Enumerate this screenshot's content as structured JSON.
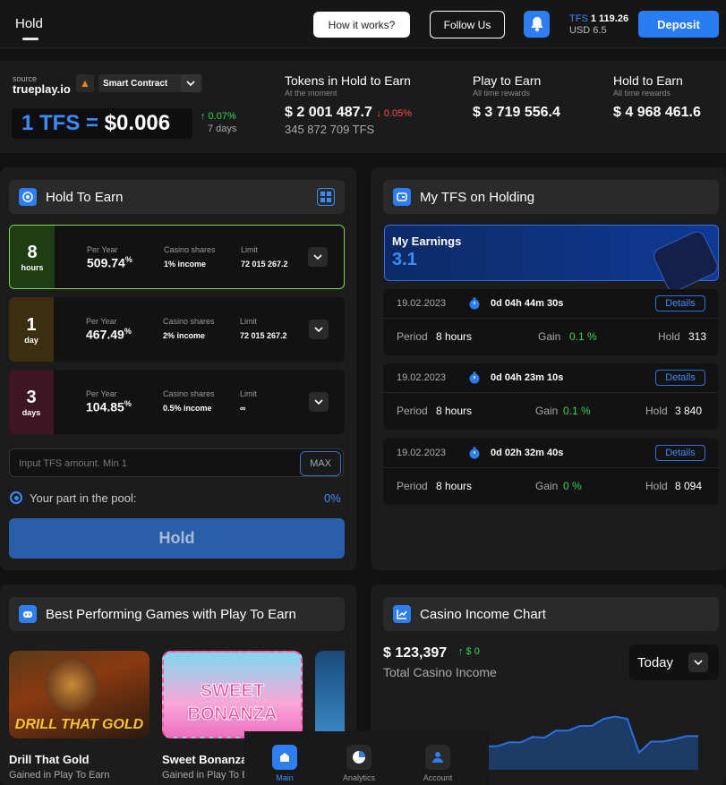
{
  "topbar": {
    "title": "Hold",
    "how_it_works": "How it works?",
    "follow_us": "Follow Us",
    "balance_tfs_prefix": "TFS",
    "balance_tfs_value": "1 119.26",
    "balance_usd": "USD 6.5",
    "deposit": "Deposit"
  },
  "stats": {
    "source_label": "source",
    "source_name": "trueplay.io",
    "smart_contract": "Smart Contract",
    "price_prefix": "1 TFS =",
    "price_value": "$0.006",
    "price_change": "↑ 0.07%",
    "price_period": "7 days",
    "tokens_title": "Tokens in Hold to Earn",
    "tokens_sub": "At the moment",
    "tokens_value": "$ 2 001 487.7",
    "tokens_change": "↓ 0.05%",
    "tokens_tfs": "345 872 709 TFS",
    "play_title": "Play to Earn",
    "play_sub": "All time rewards",
    "play_value": "$ 3 719 556.4",
    "hold_title": "Hold to Earn",
    "hold_sub": "All time rewards",
    "hold_value": "$ 4 968 461.6"
  },
  "hold_panel": {
    "title": "Hold To Earn",
    "labels": {
      "per_year": "Per Year",
      "casino_shares": "Casino shares",
      "limit": "Limit"
    },
    "plans": [
      {
        "num": "8",
        "unit": "hours",
        "rate": "509.74",
        "pct": "%",
        "shares": "1% income",
        "limit": "72 015 267.2",
        "color": "#1f3d12",
        "selected": true
      },
      {
        "num": "1",
        "unit": "day",
        "rate": "467.49",
        "pct": "%",
        "shares": "2% income",
        "limit": "72 015 267.2",
        "color": "#3d2e12",
        "selected": false
      },
      {
        "num": "3",
        "unit": "days",
        "rate": "104.85",
        "pct": "%",
        "shares": "0.5% income",
        "limit": "∞",
        "color": "#3d1523",
        "selected": false
      }
    ],
    "input_placeholder": "Input TFS amount. Min 1",
    "max": "MAX",
    "pool_label": "Your part in the pool:",
    "pool_value": "0%",
    "hold_button": "Hold"
  },
  "my_tfs": {
    "title": "My TFS on Holding",
    "earnings_title": "My Earnings",
    "earnings_value": "3.1",
    "labels": {
      "period": "Period",
      "gain": "Gain",
      "hold": "Hold",
      "details": "Details"
    },
    "items": [
      {
        "date": "19.02.2023",
        "timer": "0d 04h 44m 30s",
        "period": "8 hours",
        "gain": "0.1 %",
        "hold": "313"
      },
      {
        "date": "19.02.2023",
        "timer": "0d 04h 23m 10s",
        "period": "8 hours",
        "gain": "0.1 %",
        "hold": "3 840"
      },
      {
        "date": "19.02.2023",
        "timer": "0d 02h 32m 40s",
        "period": "8 hours",
        "gain": "0 %",
        "hold": "8 094"
      }
    ]
  },
  "games": {
    "title": "Best Performing Games with Play To Earn",
    "items": [
      {
        "name": "Drill That Gold",
        "sub": "Gained in Play To Earn",
        "art": "DRILL THAT GOLD"
      },
      {
        "name": "Sweet Bonanza",
        "sub": "Gained in Play To Earn",
        "art": "SWEET BONANZA"
      }
    ]
  },
  "nav": {
    "main": "Main",
    "analytics": "Analytics",
    "account": "Account"
  },
  "income": {
    "title": "Casino Income Chart",
    "value": "$ 123,397",
    "change": "↑ $ 0",
    "label": "Total Casino Income",
    "period": "Today"
  },
  "chart_data": {
    "type": "area",
    "title": "Casino Income Chart",
    "xlabel": "",
    "ylabel": "",
    "values": [
      3,
      3,
      3.5,
      3.5,
      4.2,
      4.1,
      5,
      5,
      5.6,
      5.6,
      6.5,
      6.8,
      6.5,
      2.2,
      3.6,
      3.6,
      3.9,
      4.3,
      4.3
    ],
    "ylim": [
      0,
      8
    ],
    "color": "#2a6fe0"
  }
}
